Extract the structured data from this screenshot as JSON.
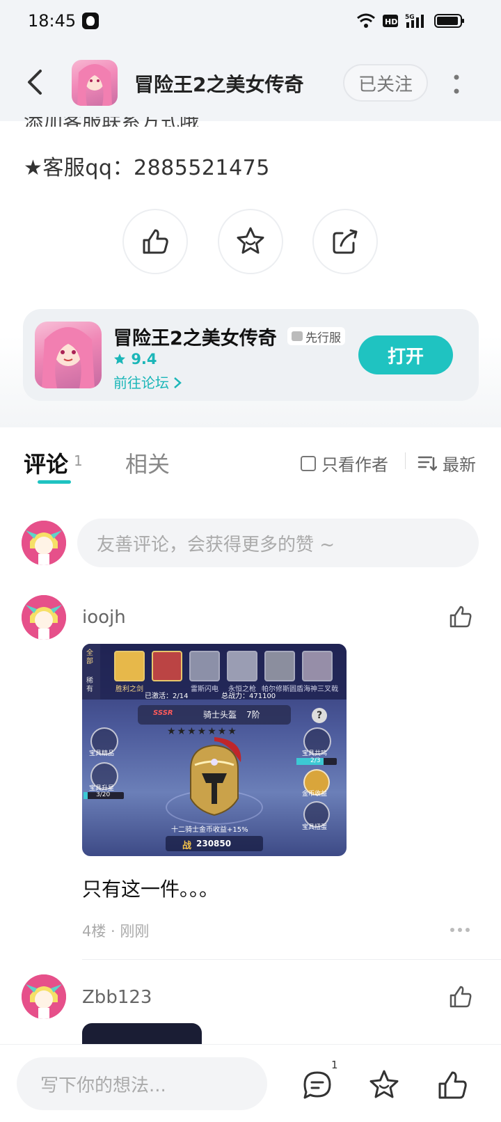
{
  "status": {
    "time": "18:45"
  },
  "header": {
    "title": "冒险王2之美女传奇",
    "follow_label": "已关注"
  },
  "post": {
    "cut_line": "添加客服联系方式哦",
    "qq_line": "★客服qq：2885521475"
  },
  "game_card": {
    "title": "冒险王2之美女传奇",
    "badge": "先行服",
    "rating": "9.4",
    "forum_link": "前往论坛",
    "open_label": "打开"
  },
  "tabs": {
    "comments_label": "评论",
    "comments_count": "1",
    "related_label": "相关",
    "author_only_label": "只看作者",
    "sort_label": "最新"
  },
  "comment_input": {
    "placeholder": "友善评论，会获得更多的赞 ~"
  },
  "comments": [
    {
      "username": "ioojh",
      "text": "只有这一件。。。",
      "meta": "4楼 · 刚刚",
      "screenshot": {
        "tab_all": "全部",
        "tab_rare": "稀有",
        "item_labels": [
          "胜利之剑",
          "",
          "雷斯闪电",
          "永恒之枪",
          "帕尔修斯圆盾",
          "海神三叉戟"
        ],
        "activated": "已激活：2/14",
        "total_power": "总战力：471100",
        "rank_badge": "SSSR",
        "item_name": "骑士头盔",
        "stage": "7阶",
        "left_btn1": "宝具精品",
        "left_btn2": "宝具升星",
        "left_progress": "3/20",
        "right_btn1": "宝具共鸣",
        "right_progress": "2/3",
        "right_btn2": "金币收益",
        "right_btn3": "宝具扭蛋",
        "bonus": "十二骑士金币收益+15%",
        "power_icon": "战",
        "power_value": "230850"
      }
    },
    {
      "username": "Zbb123"
    }
  ],
  "bottom": {
    "placeholder": "写下你的想法...",
    "comment_count": "1"
  },
  "colors": {
    "accent": "#1fc3c1",
    "background": "#f2f4f7"
  }
}
